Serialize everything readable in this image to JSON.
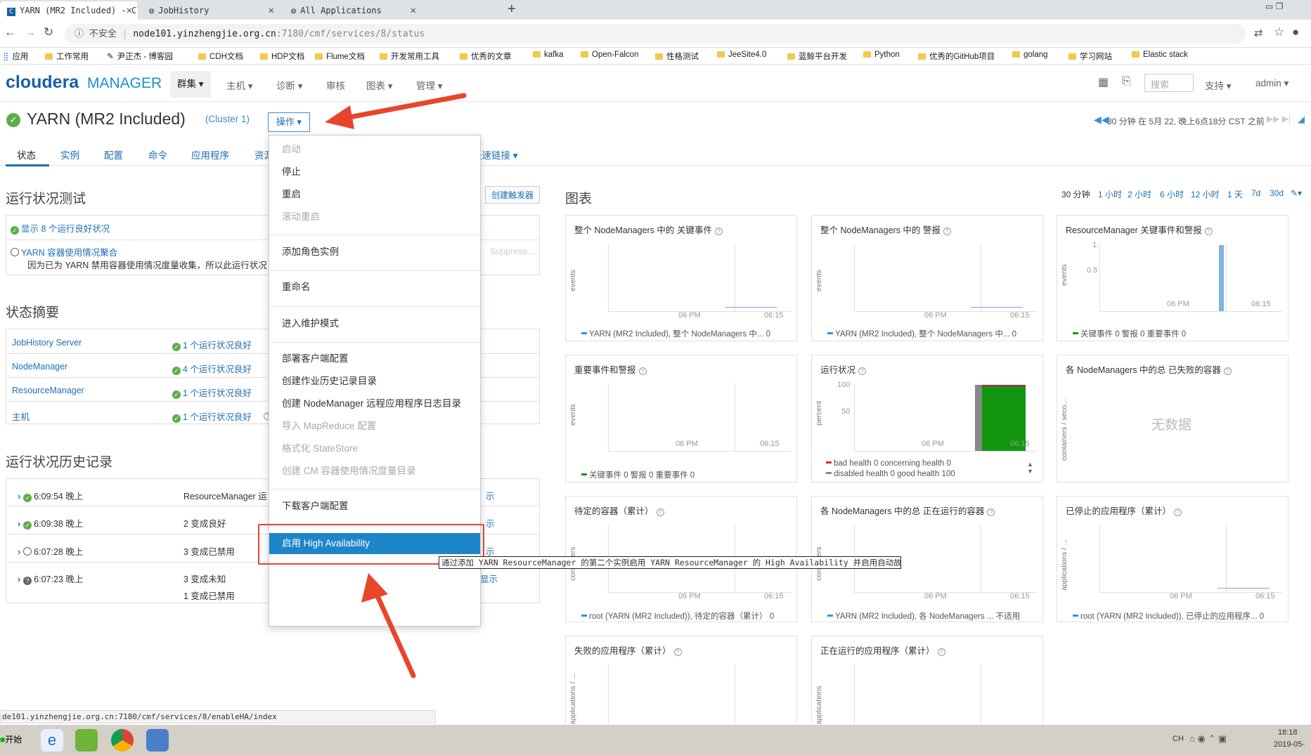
{
  "browser": {
    "tabs": [
      {
        "label": "YARN (MR2 Included) - Cloude"
      },
      {
        "label": "JobHistory"
      },
      {
        "label": "All Applications"
      }
    ],
    "url_security": "不安全",
    "url_host": "node101.yinzhengjie.org.cn",
    "url_path": ":7180/cmf/services/8/status",
    "bookmarks": [
      "应用",
      "工作常用",
      "尹正杰 - 博客园",
      "CDH文档",
      "HDP文档",
      "Flume文档",
      "开发常用工具",
      "优秀的文章",
      "kafka",
      "Open-Falcon",
      "性格测试",
      "JeeSite4.0",
      "蓝鲸平台开发",
      "Python",
      "优秀的GitHub项目",
      "golang",
      "学习网站",
      "Elastic stack"
    ]
  },
  "header": {
    "logo_main": "cloudera",
    "logo_sub": "MANAGER",
    "nav": [
      "群集",
      "主机",
      "诊断",
      "审核",
      "图表",
      "管理"
    ],
    "search_placeholder": "搜索",
    "support": "支持",
    "user": "admin"
  },
  "service": {
    "title": "YARN (MR2 Included)",
    "cluster": "(Cluster 1)",
    "actions_label": "操作",
    "time_info": "30 分钟 在 5月 22, 晚上6点18分 CST 之前"
  },
  "subtabs": [
    "状态",
    "实例",
    "配置",
    "命令",
    "应用程序",
    "资源池",
    "快速链接"
  ],
  "health_tests": {
    "title": "运行状况测试",
    "create_trigger": "创建触发器",
    "show_good": "显示 8 个运行良好状况",
    "yarn_metric": "YARN 容器使用情况聚合",
    "yarn_metric_desc": "因为已为 YARN 禁用容器使用情况度量收集，所以此运行状况",
    "suppress": "Suppress..."
  },
  "status_summary": {
    "title": "状态摘要",
    "rows": [
      {
        "name": "JobHistory Server",
        "status": "1 个运行状况良好"
      },
      {
        "name": "NodeManager",
        "status": "4 个运行状况良好"
      },
      {
        "name": "ResourceManager",
        "status": "1 个运行状况良好"
      },
      {
        "name": "主机",
        "status": "1 个运行状况良好"
      }
    ]
  },
  "history": {
    "title": "运行状况历史记录",
    "rows": [
      {
        "time": "6:09:54 晚上",
        "desc": "ResourceManager 运",
        "link": "示"
      },
      {
        "time": "6:09:38 晚上",
        "desc": "2 变成良好",
        "link": "示"
      },
      {
        "time": "6:07:28 晚上",
        "desc": "3 变成已禁用",
        "link": "示"
      },
      {
        "time": "6:07:23 晚上",
        "desc": "3 变成未知",
        "desc2": "1 变成已禁用",
        "link": "显示"
      }
    ]
  },
  "dropdown": {
    "items": [
      {
        "label": "启动",
        "disabled": true
      },
      {
        "label": "停止"
      },
      {
        "label": "重启"
      },
      {
        "label": "滚动重启",
        "disabled": true
      },
      {
        "label": "添加角色实例"
      },
      {
        "label": "重命名"
      },
      {
        "label": "进入维护模式"
      },
      {
        "label": "部署客户端配置"
      },
      {
        "label": "创建作业历史记录目录"
      },
      {
        "label": "创建 NodeManager 远程应用程序日志目录"
      },
      {
        "label": "导入 MapReduce 配置",
        "disabled": true
      },
      {
        "label": "格式化 StateStore",
        "disabled": true
      },
      {
        "label": "创建 CM 容器使用情况度量目录",
        "disabled": true
      },
      {
        "label": "下载客户端配置"
      },
      {
        "label": "启用 High Availability",
        "highlighted": true
      }
    ],
    "tooltip": "通过添加 YARN ResourceManager 的第二个实例启用 YARN ResourceManager 的 High Availability 并启用自动故障转移。"
  },
  "charts": {
    "title": "图表",
    "ranges": [
      "30 分钟",
      "1 小时",
      "2 小时",
      "6 小时",
      "12 小时",
      "1 天",
      "7d",
      "30d"
    ],
    "cards": [
      {
        "title": "整个 NodeManagers 中的 关键事件",
        "ylabel": "events",
        "ticks": [
          "06 PM",
          "06:15"
        ],
        "legend": "YARN (MR2 Included), 整个 NodeManagers 中...   0"
      },
      {
        "title": "整个 NodeManagers 中的 警报",
        "ylabel": "events",
        "ticks": [
          "06 PM",
          "06:15"
        ],
        "legend": "YARN (MR2 Included), 整个 NodeManagers 中...   0"
      },
      {
        "title": "ResourceManager 关键事件和警报",
        "ylabel": "events",
        "ticks": [
          "06 PM",
          "06:15"
        ],
        "yticks": [
          "1",
          "0.5"
        ],
        "legend": "关键事件  0   警报  0   重要事件  0"
      },
      {
        "title": "重要事件和警报",
        "ylabel": "events",
        "ticks": [
          "06 PM",
          "06:15"
        ],
        "legend": "关键事件  0   警报  0   重要事件  0"
      },
      {
        "title": "运行状况",
        "ylabel": "percent",
        "ticks": [
          "06 PM",
          "06:15"
        ],
        "yticks": [
          "100",
          "50"
        ],
        "legend1": "bad health  0    concerning health  0",
        "legend2": "disabled health  0    good health  100"
      },
      {
        "title": "各 NodeManagers 中的总 已失败的容器",
        "ylabel": "containers / seco...",
        "nodata": "无数据"
      },
      {
        "title": "待定的容器（累计）",
        "ylabel": "containers",
        "ticks": [
          "06 PM",
          "06:15"
        ],
        "legend": "root (YARN (MR2 Included)), 待定的容器（累计）  0"
      },
      {
        "title": "各 NodeManagers 中的总 正在运行的容器",
        "ylabel": "containers",
        "ticks": [
          "06 PM",
          "06:15"
        ],
        "legend": "YARN (MR2 Included), 各 NodeManagers ...   不适用"
      },
      {
        "title": "已停止的应用程序（累计）",
        "ylabel": "applications / ...",
        "ticks": [
          "06 PM",
          "06:15"
        ],
        "legend": "root (YARN (MR2 Included)), 已停止的应用程序...   0"
      },
      {
        "title": "失败的应用程序（累计）",
        "ylabel": "applications / ..."
      },
      {
        "title": "正在运行的应用程序（累计）",
        "ylabel": "applications"
      }
    ]
  },
  "status_url": "de101.yinzhengjie.org.cn:7180/cmf/services/8/enableHA/index",
  "taskbar": {
    "start": "开始",
    "lang": "CH",
    "time": "18:18",
    "date": "2019-05-"
  },
  "colors": {
    "brand": "#1a5fa8",
    "link": "#1e6fb5",
    "highlight": "#1e86c8",
    "annotation": "#e8452c",
    "good": "#5aaf4a"
  }
}
